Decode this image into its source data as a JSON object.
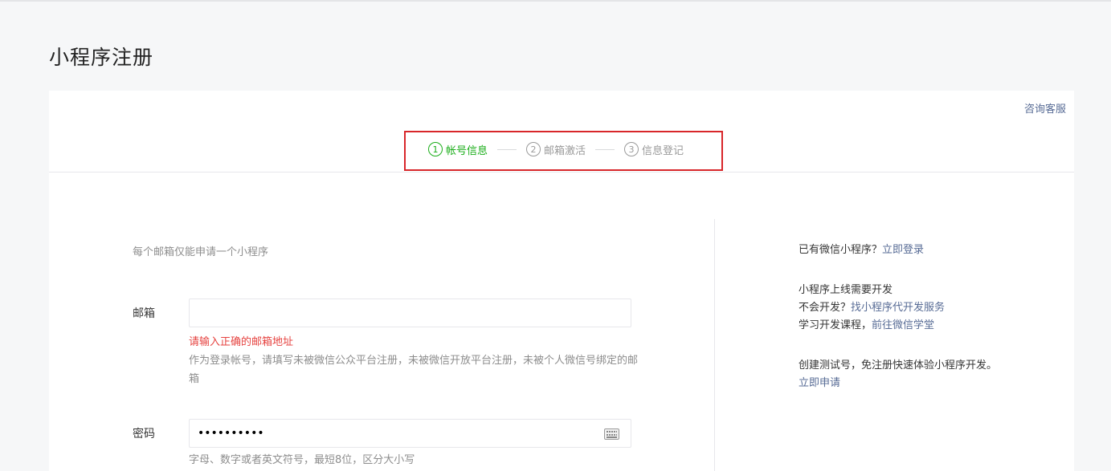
{
  "page": {
    "title": "小程序注册"
  },
  "header": {
    "consult": "咨询客服"
  },
  "steps": [
    {
      "num": "1",
      "label": "帐号信息",
      "active": true
    },
    {
      "num": "2",
      "label": "邮箱激活",
      "active": false
    },
    {
      "num": "3",
      "label": "信息登记",
      "active": false
    }
  ],
  "form": {
    "notice": "每个邮箱仅能申请一个小程序",
    "email": {
      "label": "邮箱",
      "value": "",
      "placeholder": "",
      "error": "请输入正确的邮箱地址",
      "tip": "作为登录帐号，请填写未被微信公众平台注册，未被微信开放平台注册，未被个人微信号绑定的邮箱"
    },
    "password": {
      "label": "密码",
      "value": "••••••••••",
      "tip": "字母、数字或者英文符号，最短8位，区分大小写"
    }
  },
  "sidebar": {
    "login_prefix": "已有微信小程序？",
    "login_link": "立即登录",
    "dev_line1": "小程序上线需要开发",
    "dev_line2_prefix": "不会开发？",
    "dev_line2_link": "找小程序代开发服务",
    "dev_line3_prefix": "学习开发课程，",
    "dev_line3_link": "前往微信学堂",
    "test_prefix": "创建测试号，免注册快速体验小程序开发。",
    "test_link": "立即申请"
  },
  "colors": {
    "active_step": "#1aad19",
    "link": "#576b95",
    "error": "#e64340",
    "highlight_frame": "#d8262a"
  }
}
